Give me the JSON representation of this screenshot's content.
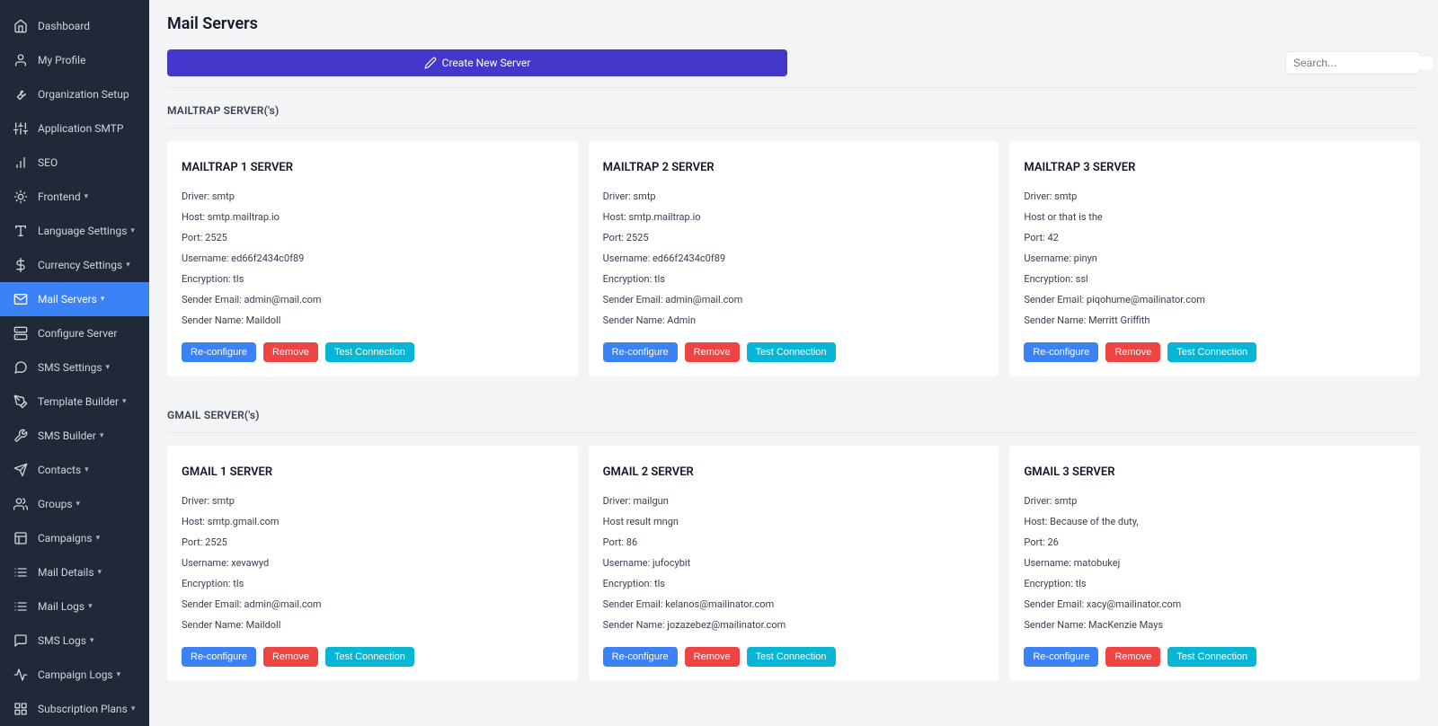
{
  "page": {
    "title": "Mail Servers"
  },
  "search": {
    "placeholder": "Search..."
  },
  "toolbar": {
    "create_label": "Create New Server"
  },
  "sidebar": {
    "items": [
      {
        "label": "Dashboard",
        "icon": "home-icon",
        "caret": false
      },
      {
        "label": "My Profile",
        "icon": "user-icon",
        "caret": false
      },
      {
        "label": "Organization Setup",
        "icon": "wrench-icon",
        "caret": false
      },
      {
        "label": "Application SMTP",
        "icon": "sliders-icon",
        "caret": false
      },
      {
        "label": "SEO",
        "icon": "bar-chart-icon",
        "caret": false
      },
      {
        "label": "Frontend",
        "icon": "sparkle-icon",
        "caret": true
      },
      {
        "label": "Language Settings",
        "icon": "type-icon",
        "caret": true
      },
      {
        "label": "Currency Settings",
        "icon": "dollar-icon",
        "caret": true
      },
      {
        "label": "Mail Servers",
        "icon": "mail-icon",
        "caret": true,
        "active": true
      },
      {
        "label": "Configure Server",
        "icon": "server-icon",
        "caret": false
      },
      {
        "label": "SMS Settings",
        "icon": "message-icon",
        "caret": true
      },
      {
        "label": "Template Builder",
        "icon": "pen-tool-icon",
        "caret": true
      },
      {
        "label": "SMS Builder",
        "icon": "tool-icon",
        "caret": true
      },
      {
        "label": "Contacts",
        "icon": "send-icon",
        "caret": true
      },
      {
        "label": "Groups",
        "icon": "users-icon",
        "caret": true
      },
      {
        "label": "Campaigns",
        "icon": "layout-icon",
        "caret": true
      },
      {
        "label": "Mail Details",
        "icon": "list-icon",
        "caret": true
      },
      {
        "label": "Mail Logs",
        "icon": "list-icon",
        "caret": true
      },
      {
        "label": "SMS Logs",
        "icon": "message-square-icon",
        "caret": true
      },
      {
        "label": "Campaign Logs",
        "icon": "activity-icon",
        "caret": true
      },
      {
        "label": "Subscription Plans",
        "icon": "grid-icon",
        "caret": true
      }
    ]
  },
  "sections": [
    {
      "heading": "MAILTRAP SERVER('s)",
      "servers": [
        {
          "title": "MAILTRAP 1 SERVER",
          "driver": "Driver: smtp",
          "host": "Host: smtp.mailtrap.io",
          "port": "Port: 2525",
          "username": "Username: ed66f2434c0f89",
          "encryption": "Encryption: tls",
          "sender_email": "Sender Email: admin@mail.com",
          "sender_name": "Sender Name: Maildoll"
        },
        {
          "title": "MAILTRAP 2 SERVER",
          "driver": "Driver: smtp",
          "host": "Host: smtp.mailtrap.io",
          "port": "Port: 2525",
          "username": "Username: ed66f2434c0f89",
          "encryption": "Encryption: tls",
          "sender_email": "Sender Email: admin@mail.com",
          "sender_name": "Sender Name: Admin"
        },
        {
          "title": "MAILTRAP 3 SERVER",
          "driver": "Driver: smtp",
          "host": "Host or that is the",
          "port": "Port: 42",
          "username": "Username: pinyn",
          "encryption": "Encryption: ssl",
          "sender_email": "Sender Email: piqohume@mailinator.com",
          "sender_name": "Sender Name: Merritt Griffith"
        }
      ]
    },
    {
      "heading": "GMAIL SERVER('s)",
      "servers": [
        {
          "title": "GMAIL 1 SERVER",
          "driver": "Driver: smtp",
          "host": "Host: smtp.gmail.com",
          "port": "Port: 2525",
          "username": "Username: xevawyd",
          "encryption": "Encryption: tls",
          "sender_email": "Sender Email: admin@mail.com",
          "sender_name": "Sender Name: Maildoll"
        },
        {
          "title": "GMAIL 2 SERVER",
          "driver": "Driver: mailgun",
          "host": "Host result mngn",
          "port": "Port: 86",
          "username": "Username: jufocybit",
          "encryption": "Encryption: tls",
          "sender_email": "Sender Email: kelanos@mailinator.com",
          "sender_name": "Sender Name: jozazebez@mailinator.com"
        },
        {
          "title": "GMAIL 3 SERVER",
          "driver": "Driver: smtp",
          "host": "Host: Because of the duty,",
          "port": "Port: 26",
          "username": "Username: matobukej",
          "encryption": "Encryption: tls",
          "sender_email": "Sender Email: xacy@mailinator.com",
          "sender_name": "Sender Name: MacKenzie Mays"
        }
      ]
    }
  ],
  "buttons": {
    "reconfigure": "Re-configure",
    "remove": "Remove",
    "test": "Test Connection"
  }
}
